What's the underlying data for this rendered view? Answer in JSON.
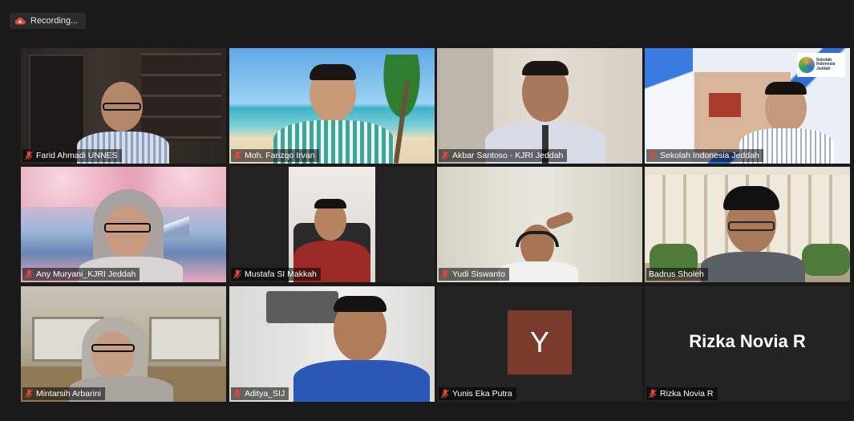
{
  "recording": {
    "label": "Recording...",
    "icon": "cloud-record-icon",
    "color": "#e8493b"
  },
  "colors": {
    "active_speaker": "#d9e86b",
    "avatar_bg": "#7a3b2c",
    "muted_icon": "#e0483a"
  },
  "participants": [
    {
      "name": "Farid Ahmadi UNNES",
      "muted": true
    },
    {
      "name": "Moh. Farizqo Irvan",
      "muted": true
    },
    {
      "name": "Akbar Santoso - KJRI Jeddah",
      "muted": true
    },
    {
      "name": "Sekolah Indonesia Jeddah",
      "muted": true,
      "logo_text": "Sekolah Indonesia Jeddah"
    },
    {
      "name": "Any Muryani_KJRI Jeddah",
      "muted": true
    },
    {
      "name": "Mustafa SI Makkah",
      "muted": true
    },
    {
      "name": "Yudi Siswanto",
      "muted": true
    },
    {
      "name": "Badrus Sholeh",
      "muted": false,
      "active_speaker": true
    },
    {
      "name": "Mintarsih Arbarini",
      "muted": true
    },
    {
      "name": "Aditya_SIJ",
      "muted": true
    },
    {
      "name": "Yunis Eka Putra",
      "muted": true,
      "avatar_letter": "Y"
    },
    {
      "name": "Rizka Novia R",
      "muted": true,
      "display_name": "Rizka Novia R"
    }
  ]
}
